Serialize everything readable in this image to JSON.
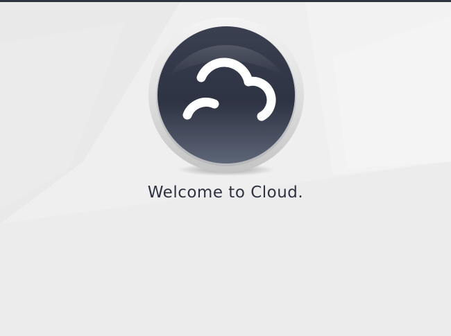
{
  "welcome": {
    "message": "Welcome to Cloud."
  },
  "logo": {
    "icon": "cloud-icon"
  },
  "colors": {
    "background": "#ececec",
    "top_bar": "#2f3441",
    "logo_dark": "#2e3343",
    "text": "#2e3240"
  }
}
